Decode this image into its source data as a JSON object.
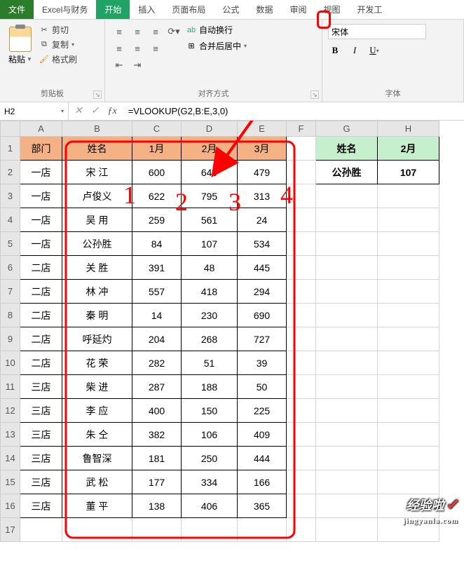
{
  "menu": {
    "file": "文件",
    "excel_finance": "Excel与财务",
    "home": "开始",
    "insert": "插入",
    "page_layout": "页面布局",
    "formulas": "公式",
    "data": "数据",
    "review": "审阅",
    "view": "视图",
    "dev": "开发工"
  },
  "ribbon": {
    "paste": "粘贴",
    "cut": "剪切",
    "copy": "复制",
    "format_painter": "格式刷",
    "clipboard_label": "剪贴板",
    "wrap_text": "自动换行",
    "merge_center": "合并后居中",
    "alignment_label": "对齐方式",
    "font_name": "宋体",
    "font_label": "字体"
  },
  "formula_bar": {
    "cell_ref": "H2",
    "formula": "=VLOOKUP(G2,B:E,3,0)"
  },
  "columns": [
    "A",
    "B",
    "C",
    "D",
    "E",
    "F",
    "G",
    "H"
  ],
  "headers": {
    "dept": "部门",
    "name": "姓名",
    "m1": "1月",
    "m2": "2月",
    "m3": "3月"
  },
  "lookup": {
    "name_label": "姓名",
    "month_label": "2月",
    "name_value": "公孙胜",
    "result": "107"
  },
  "rows": [
    {
      "dept": "一店",
      "name": "宋 江",
      "m1": "600",
      "m2": "649",
      "m3": "479"
    },
    {
      "dept": "一店",
      "name": "卢俊义",
      "m1": "622",
      "m2": "795",
      "m3": "313"
    },
    {
      "dept": "一店",
      "name": "吴 用",
      "m1": "259",
      "m2": "561",
      "m3": "24"
    },
    {
      "dept": "一店",
      "name": "公孙胜",
      "m1": "84",
      "m2": "107",
      "m3": "534"
    },
    {
      "dept": "二店",
      "name": "关 胜",
      "m1": "391",
      "m2": "48",
      "m3": "445"
    },
    {
      "dept": "二店",
      "name": "林 冲",
      "m1": "557",
      "m2": "418",
      "m3": "294"
    },
    {
      "dept": "二店",
      "name": "秦 明",
      "m1": "14",
      "m2": "230",
      "m3": "690"
    },
    {
      "dept": "二店",
      "name": "呼延灼",
      "m1": "204",
      "m2": "268",
      "m3": "727"
    },
    {
      "dept": "二店",
      "name": "花 荣",
      "m1": "282",
      "m2": "51",
      "m3": "39"
    },
    {
      "dept": "三店",
      "name": "柴 进",
      "m1": "287",
      "m2": "188",
      "m3": "50"
    },
    {
      "dept": "三店",
      "name": "李 应",
      "m1": "400",
      "m2": "150",
      "m3": "225"
    },
    {
      "dept": "三店",
      "name": "朱 仝",
      "m1": "382",
      "m2": "106",
      "m3": "409"
    },
    {
      "dept": "三店",
      "name": "鲁智深",
      "m1": "181",
      "m2": "250",
      "m3": "444"
    },
    {
      "dept": "三店",
      "name": "武 松",
      "m1": "177",
      "m2": "334",
      "m3": "166"
    },
    {
      "dept": "三店",
      "name": "董 平",
      "m1": "138",
      "m2": "406",
      "m3": "365"
    }
  ],
  "annotations": {
    "n1": "1",
    "n2": "2",
    "n3": "3",
    "n4": "4"
  },
  "watermark": {
    "main": "经验啦",
    "domain": "jingyanla.com"
  }
}
